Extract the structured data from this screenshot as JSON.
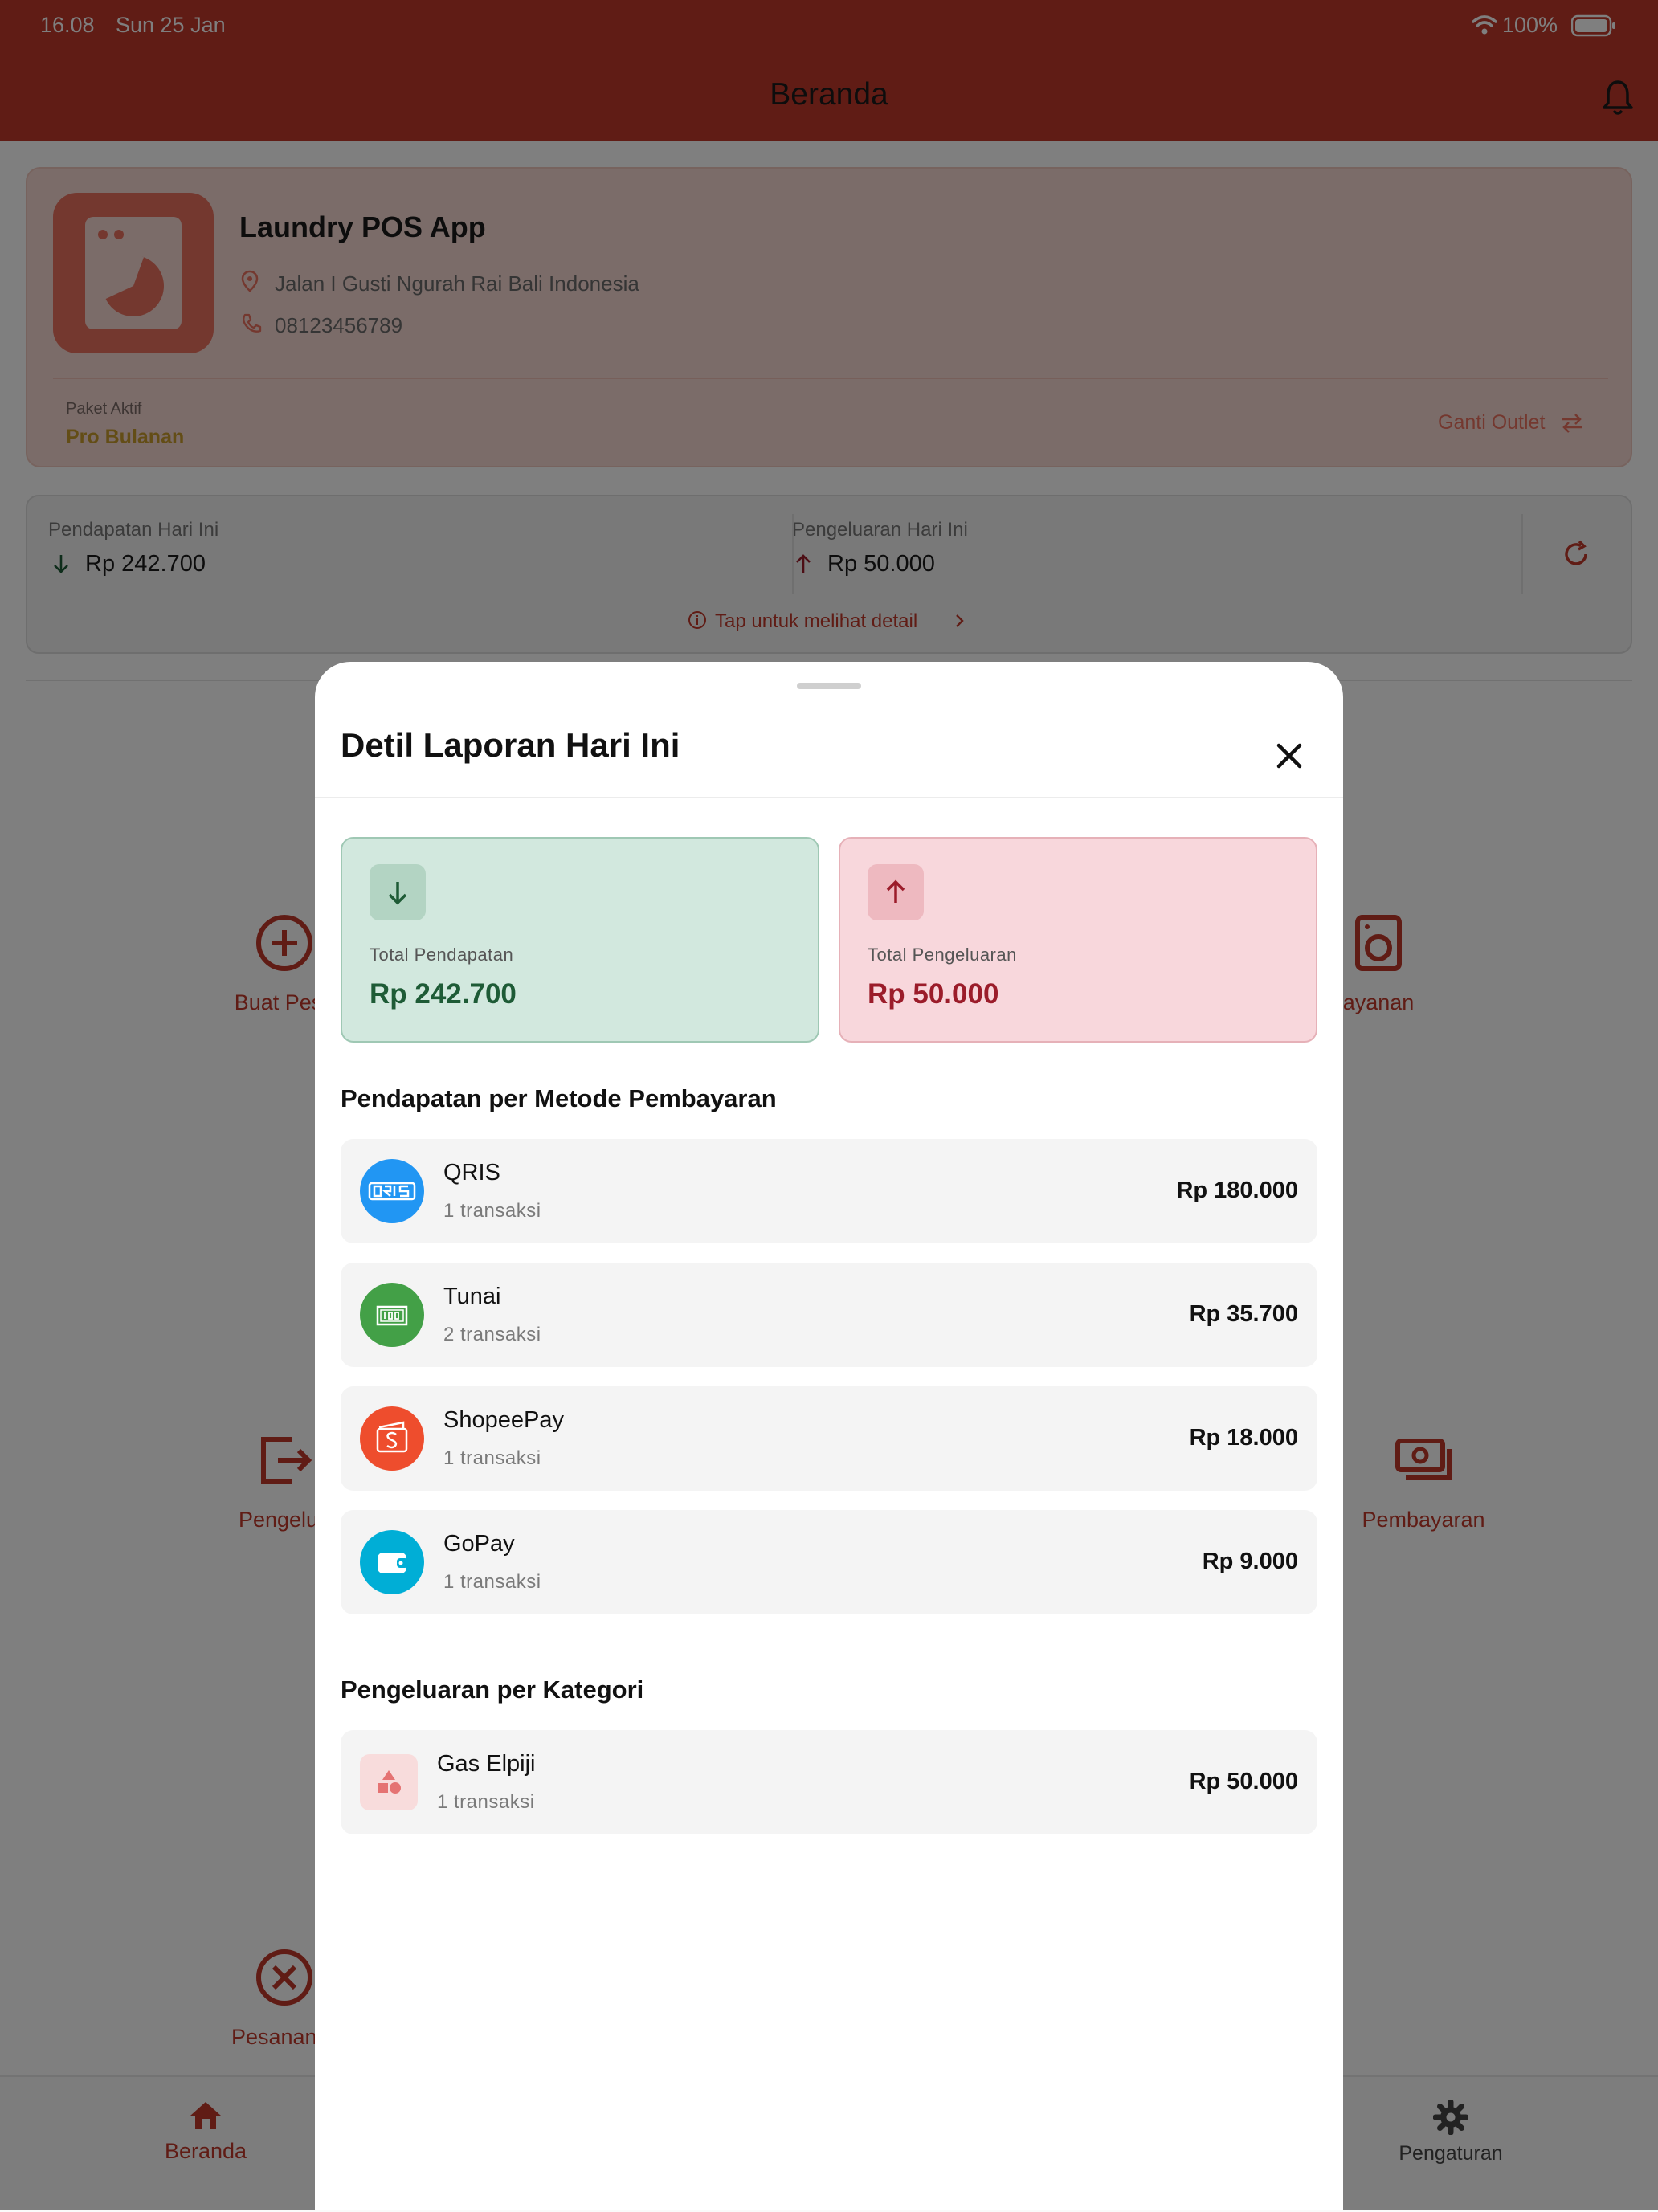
{
  "status_bar": {
    "time": "16.08",
    "date": "Sun 25 Jan",
    "battery": "100%"
  },
  "app_bar": {
    "title": "Beranda"
  },
  "outlet": {
    "name": "Laundry POS App",
    "address": "Jalan I Gusti Ngurah Rai Bali Indonesia",
    "phone": "08123456789",
    "plan_label": "Paket Aktif",
    "plan_value": "Pro Bulanan",
    "switch_label": "Ganti Outlet"
  },
  "summary": {
    "income_label": "Pendapatan Hari Ini",
    "income_value": "Rp 242.700",
    "expense_label": "Pengeluaran Hari Ini",
    "expense_value": "Rp 50.000",
    "detail_hint": "Tap untuk melihat detail"
  },
  "menu": {
    "left": [
      "Buat Pesa",
      "Pengelua",
      "Pesanan B"
    ],
    "right": [
      "ayanan",
      "Pembayaran"
    ]
  },
  "bottom_nav": {
    "home": "Beranda",
    "settings": "Pengaturan"
  },
  "sheet": {
    "title": "Detil Laporan Hari Ini",
    "total_income_label": "Total Pendapatan",
    "total_income_value": "Rp 242.700",
    "total_expense_label": "Total Pengeluaran",
    "total_expense_value": "Rp 50.000",
    "payment_section_title": "Pendapatan per Metode Pembayaran",
    "payments": [
      {
        "name": "QRIS",
        "count": "1 transaksi",
        "amount": "Rp 180.000",
        "color": "#2196f3",
        "icon": "qris-icon"
      },
      {
        "name": "Tunai",
        "count": "2 transaksi",
        "amount": "Rp 35.700",
        "color": "#43a047",
        "icon": "cash-icon"
      },
      {
        "name": "ShopeePay",
        "count": "1 transaksi",
        "amount": "Rp 18.000",
        "color": "#ee4d2d",
        "icon": "shopeepay-icon"
      },
      {
        "name": "GoPay",
        "count": "1 transaksi",
        "amount": "Rp 9.000",
        "color": "#00aed6",
        "icon": "gopay-icon"
      }
    ],
    "category_section_title": "Pengeluaran per Kategori",
    "categories": [
      {
        "name": "Gas Elpiji",
        "count": "1 transaksi",
        "amount": "Rp 50.000",
        "icon": "category-shapes-icon"
      }
    ]
  },
  "colors": {
    "brand": "#c0392b",
    "income": "#1e5b36",
    "expense": "#9b1c2a"
  }
}
